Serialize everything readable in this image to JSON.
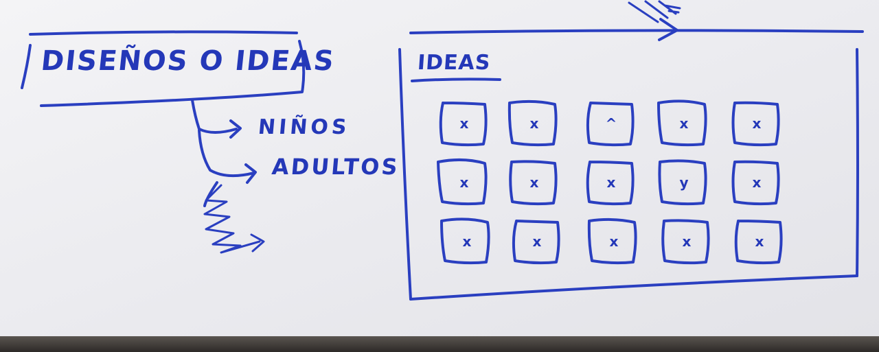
{
  "main_box": {
    "label": "DISEÑOS O IDEAS"
  },
  "branches": [
    {
      "label": "NIÑOS"
    },
    {
      "label": "ADULTOS"
    }
  ],
  "ideas_panel": {
    "title": "IDEAS",
    "cards": [
      {
        "mark": "x"
      },
      {
        "mark": "x"
      },
      {
        "mark": "^"
      },
      {
        "mark": "x"
      },
      {
        "mark": "x"
      },
      {
        "mark": "x"
      },
      {
        "mark": "x"
      },
      {
        "mark": "x"
      },
      {
        "mark": "y"
      },
      {
        "mark": "x"
      },
      {
        "mark": "x"
      },
      {
        "mark": "x"
      },
      {
        "mark": "x"
      },
      {
        "mark": "x"
      },
      {
        "mark": "x"
      }
    ]
  },
  "colors": {
    "ink": "#2a3fc0",
    "paper": "#ededf0"
  }
}
